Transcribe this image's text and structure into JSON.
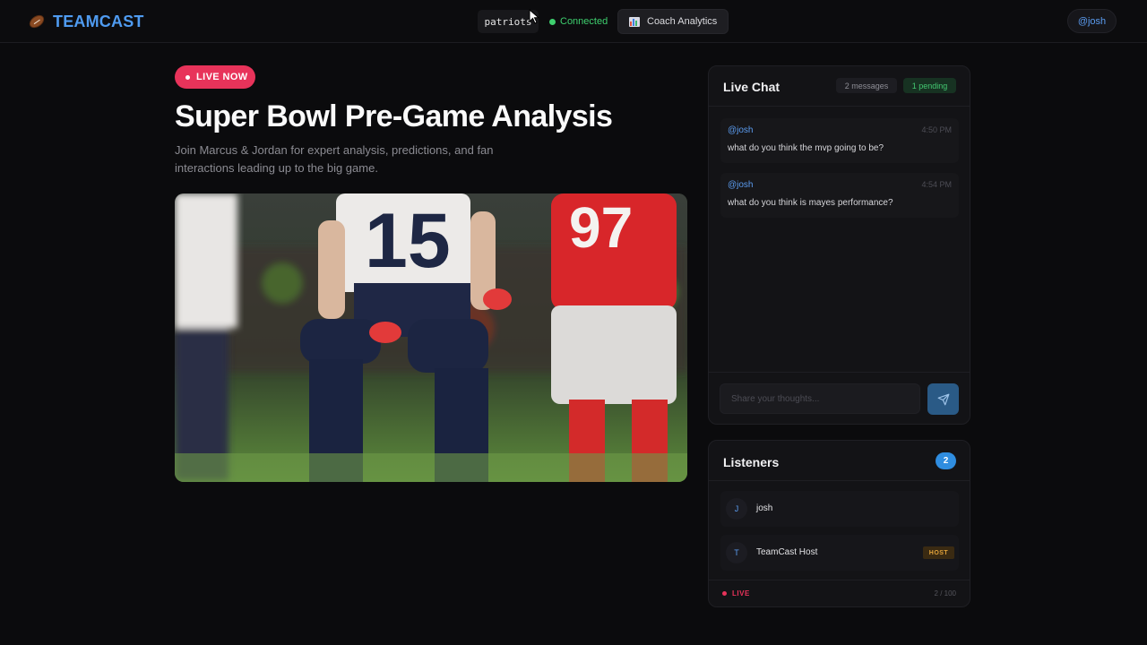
{
  "header": {
    "brand": "TEAMCAST",
    "brand_icon": "football-icon",
    "team_filter": "patriots",
    "connection_status": "Connected",
    "coach_analytics_label": "Coach Analytics",
    "coach_icon": "bar-chart-icon",
    "user_handle": "@josh"
  },
  "stream": {
    "live_badge": "LIVE NOW",
    "title": "Super Bowl Pre-Game Analysis",
    "description": "Join Marcus & Jordan for expert analysis, predictions, and fan interactions leading up to the big game.",
    "hero_image": "football-players-photo"
  },
  "chat": {
    "title": "Live Chat",
    "message_count": "2 messages",
    "pending": "1 pending",
    "messages": [
      {
        "user": "@josh",
        "time": "4:50 PM",
        "text": "what do you think the mvp going to be?"
      },
      {
        "user": "@josh",
        "time": "4:54 PM",
        "text": "what do you think is mayes performance?"
      }
    ],
    "input_placeholder": "Share your thoughts...",
    "send_icon": "send-icon"
  },
  "listeners": {
    "title": "Listeners",
    "count": "2",
    "items": [
      {
        "initial": "J",
        "name": "josh",
        "badge": ""
      },
      {
        "initial": "T",
        "name": "TeamCast Host",
        "badge": "HOST"
      }
    ],
    "live_label": "LIVE",
    "capacity": "2 / 100"
  },
  "colors": {
    "accent_blue": "#4f9bf0",
    "live_red": "#e8335a",
    "connected_green": "#3ecf6e",
    "host_amber": "#e1a23a"
  }
}
